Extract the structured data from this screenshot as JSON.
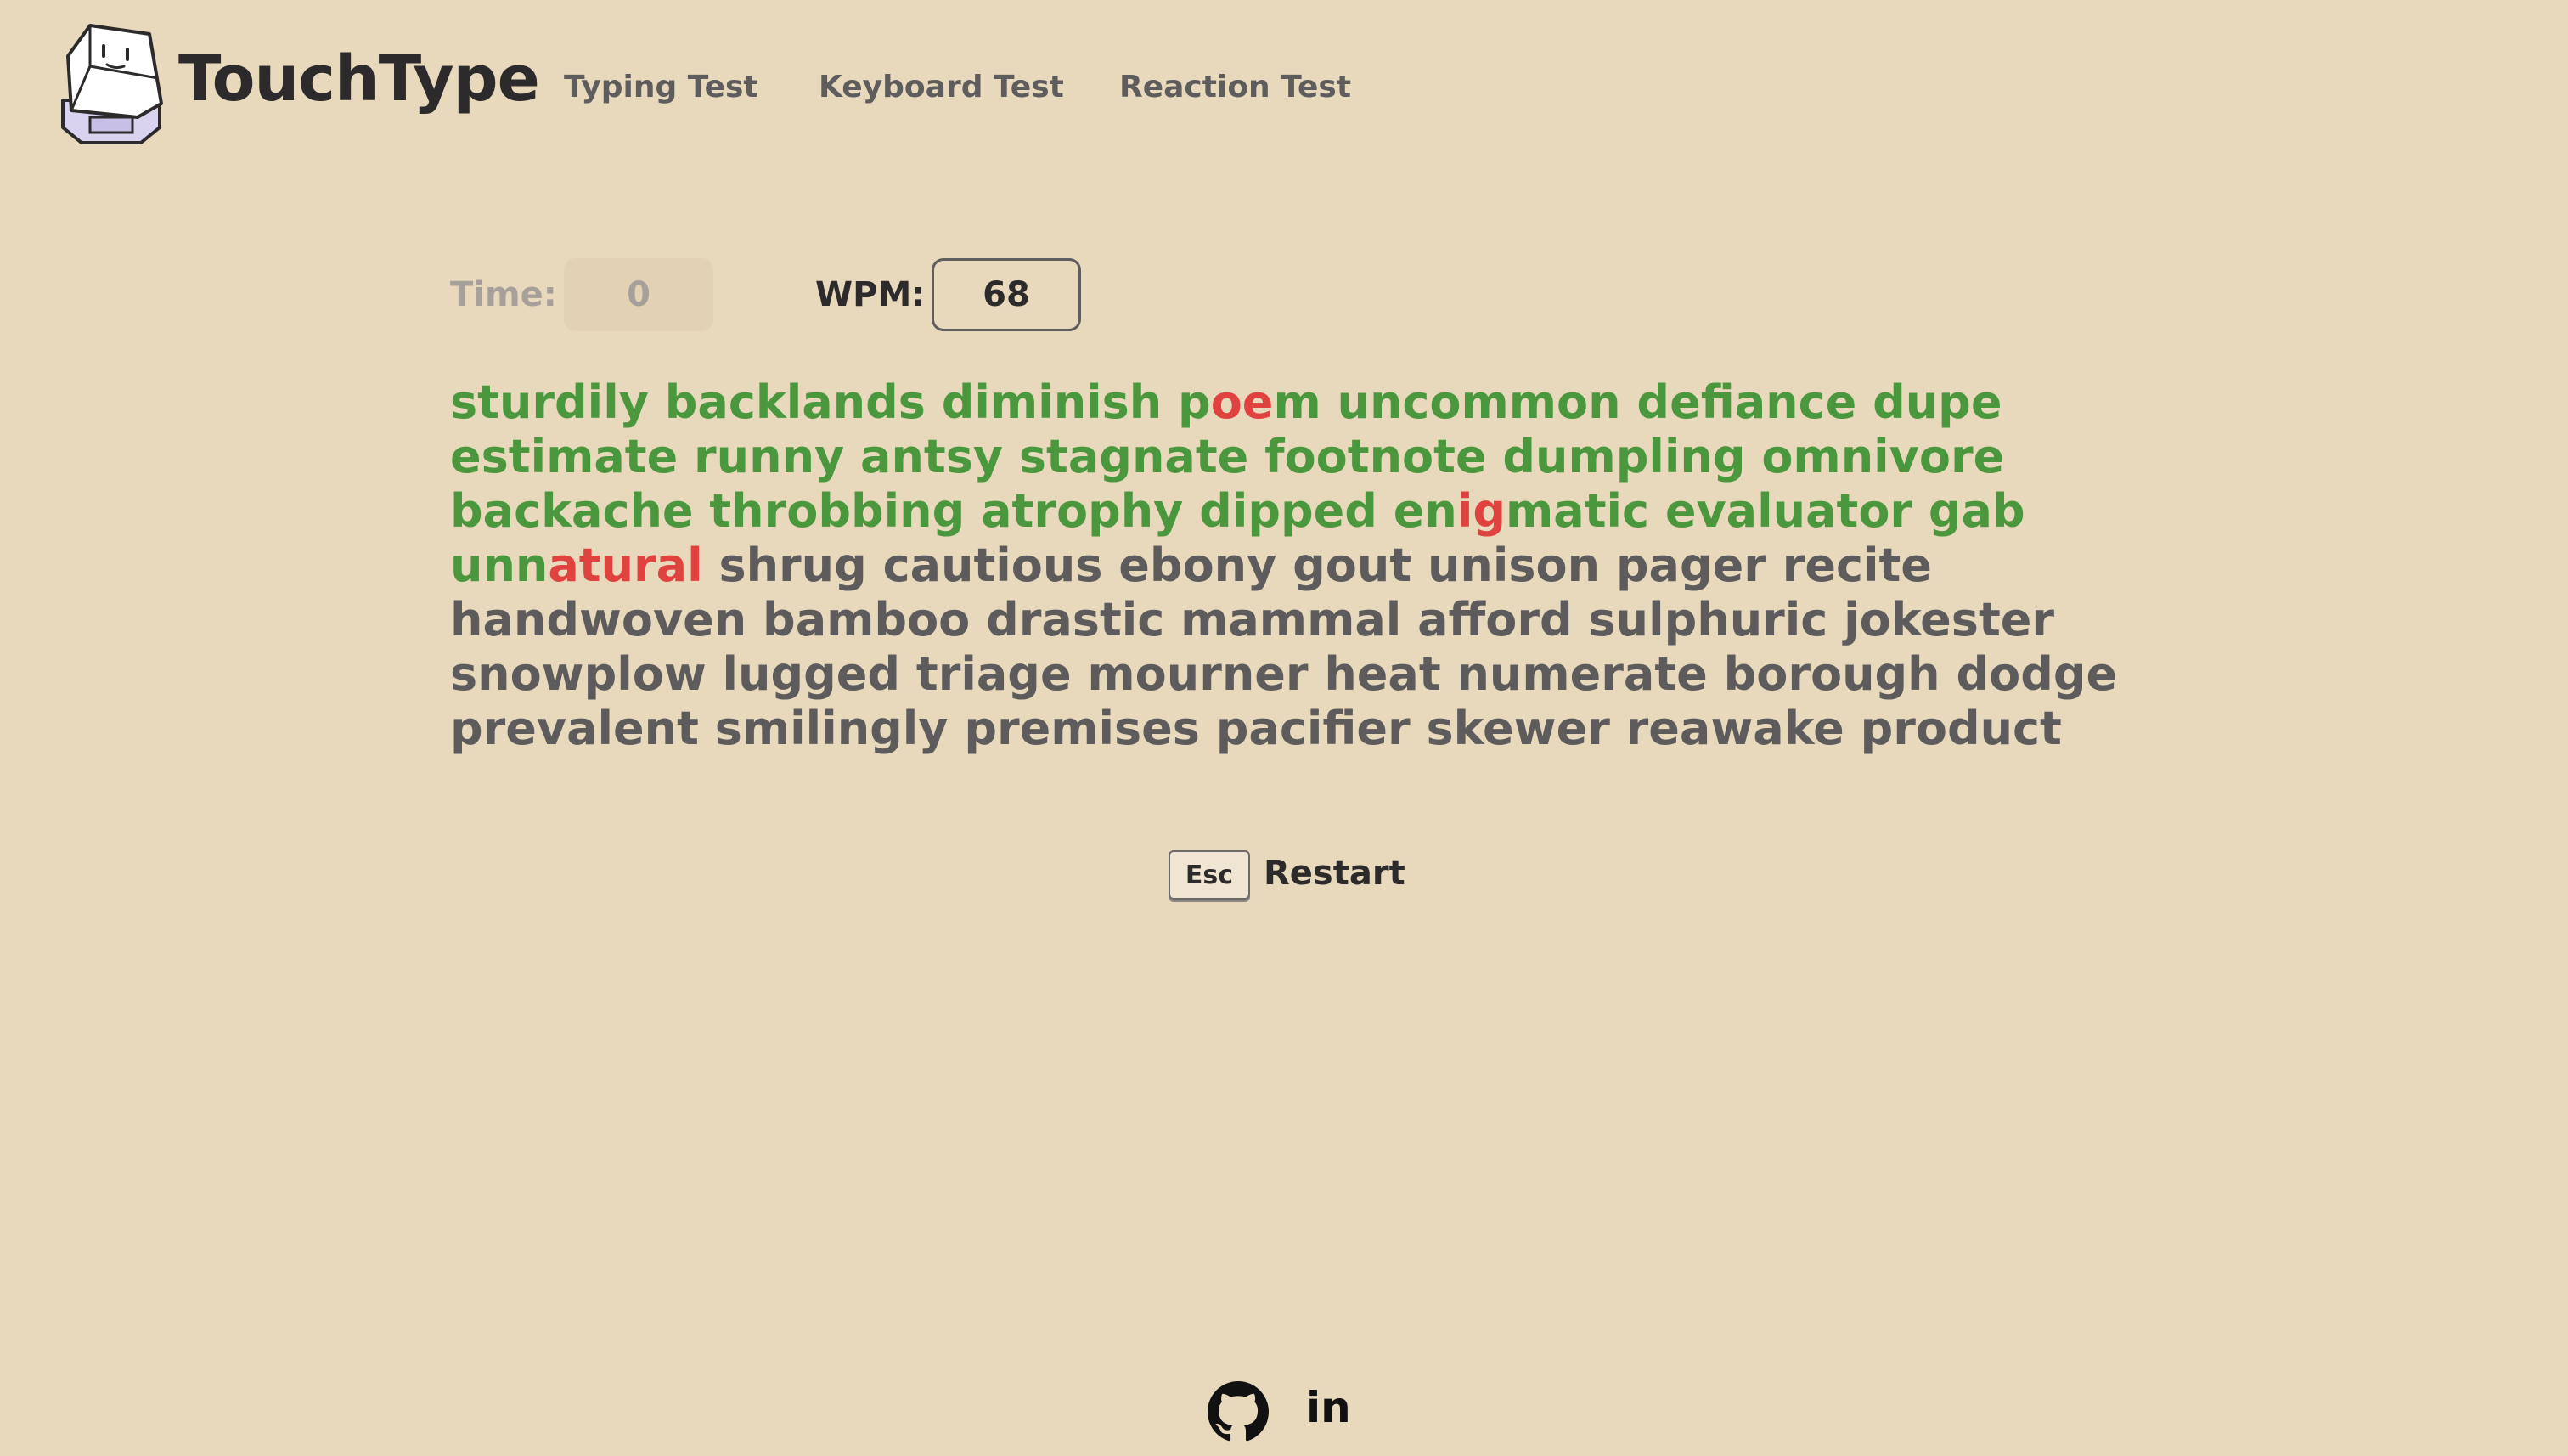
{
  "app": {
    "brand": "TouchType"
  },
  "nav": {
    "items": [
      {
        "label": "Typing Test"
      },
      {
        "label": "Keyboard Test"
      },
      {
        "label": "Reaction Test"
      }
    ]
  },
  "stats": {
    "time_label": "Time:",
    "time_value": "0",
    "wpm_label": "WPM:",
    "wpm_value": "68"
  },
  "words": {
    "lines": [
      [
        {
          "text": "sturdily",
          "state": "correct"
        },
        {
          "text": "backlands",
          "state": "correct"
        },
        {
          "text": "diminish",
          "state": "correct"
        },
        {
          "chars": [
            {
              "t": "p",
              "s": "ok"
            },
            {
              "t": "oe",
              "s": "err"
            },
            {
              "t": "m",
              "s": "ok"
            }
          ]
        },
        {
          "text": "uncommon",
          "state": "correct"
        },
        {
          "text": "defiance",
          "state": "correct"
        },
        {
          "text": "dupe",
          "state": "correct"
        }
      ],
      [
        {
          "text": "estimate",
          "state": "correct"
        },
        {
          "text": "runny",
          "state": "correct"
        },
        {
          "text": "antsy",
          "state": "correct"
        },
        {
          "text": "stagnate",
          "state": "correct"
        },
        {
          "text": "footnote",
          "state": "correct"
        },
        {
          "text": "dumpling",
          "state": "correct"
        },
        {
          "text": "omnivore",
          "state": "correct"
        }
      ],
      [
        {
          "text": "backache",
          "state": "correct"
        },
        {
          "text": "throbbing",
          "state": "correct"
        },
        {
          "text": "atrophy",
          "state": "correct"
        },
        {
          "text": "dipped",
          "state": "correct"
        },
        {
          "chars": [
            {
              "t": "en",
              "s": "ok"
            },
            {
              "t": "ig",
              "s": "err"
            },
            {
              "t": "matic",
              "s": "ok"
            }
          ]
        },
        {
          "text": "evaluator",
          "state": "correct"
        },
        {
          "text": "gab",
          "state": "correct"
        }
      ],
      [
        {
          "chars": [
            {
              "t": "unn",
              "s": "ok"
            },
            {
              "t": "atural",
              "s": "err"
            }
          ]
        },
        {
          "text": "shrug",
          "state": "pending"
        },
        {
          "text": "cautious",
          "state": "pending"
        },
        {
          "text": "ebony",
          "state": "pending"
        },
        {
          "text": "gout",
          "state": "pending"
        },
        {
          "text": "unison",
          "state": "pending"
        },
        {
          "text": "pager",
          "state": "pending"
        },
        {
          "text": "recite",
          "state": "pending"
        }
      ],
      [
        {
          "text": "handwoven",
          "state": "pending"
        },
        {
          "text": "bamboo",
          "state": "pending"
        },
        {
          "text": "drastic",
          "state": "pending"
        },
        {
          "text": "mammal",
          "state": "pending"
        },
        {
          "text": "afford",
          "state": "pending"
        },
        {
          "text": "sulphuric",
          "state": "pending"
        },
        {
          "text": "jokester",
          "state": "pending"
        }
      ],
      [
        {
          "text": "snowplow",
          "state": "pending"
        },
        {
          "text": "lugged",
          "state": "pending"
        },
        {
          "text": "triage",
          "state": "pending"
        },
        {
          "text": "mourner",
          "state": "pending"
        },
        {
          "text": "heat",
          "state": "pending"
        },
        {
          "text": "numerate",
          "state": "pending"
        },
        {
          "text": "borough",
          "state": "pending"
        },
        {
          "text": "dodge",
          "state": "pending"
        }
      ],
      [
        {
          "text": "prevalent",
          "state": "pending"
        },
        {
          "text": "smilingly",
          "state": "pending"
        },
        {
          "text": "premises",
          "state": "pending"
        },
        {
          "text": "pacifier",
          "state": "pending"
        },
        {
          "text": "skewer",
          "state": "pending"
        },
        {
          "text": "reawake",
          "state": "pending"
        },
        {
          "text": "product",
          "state": "pending"
        }
      ]
    ]
  },
  "restart": {
    "key_label": "Esc",
    "label": "Restart"
  },
  "footer": {
    "icons": [
      "github-icon",
      "linkedin-icon"
    ],
    "linkedin_text": "in"
  },
  "colors": {
    "background": "#e8d9bd",
    "correct": "#4a973d",
    "error": "#e0433f",
    "pending": "#5d5b5b"
  }
}
